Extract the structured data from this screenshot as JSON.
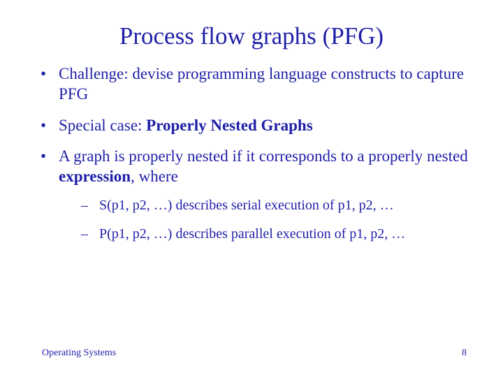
{
  "title": "Process flow graphs (PFG)",
  "bullets": {
    "b1": "Challenge: devise programming language constructs to capture PFG",
    "b2_pre": "Special case: ",
    "b2_bold": "Properly Nested Graphs",
    "b3_pre": "A graph is properly nested if it corresponds to a properly nested ",
    "b3_bold": "expression",
    "b3_post": ", where",
    "sub1": "S(p1, p2, …) describes serial execution of p1, p2, …",
    "sub2": "P(p1, p2, …) describes parallel execution of p1, p2, …"
  },
  "footer": {
    "left": "Operating Systems",
    "page": "8"
  }
}
